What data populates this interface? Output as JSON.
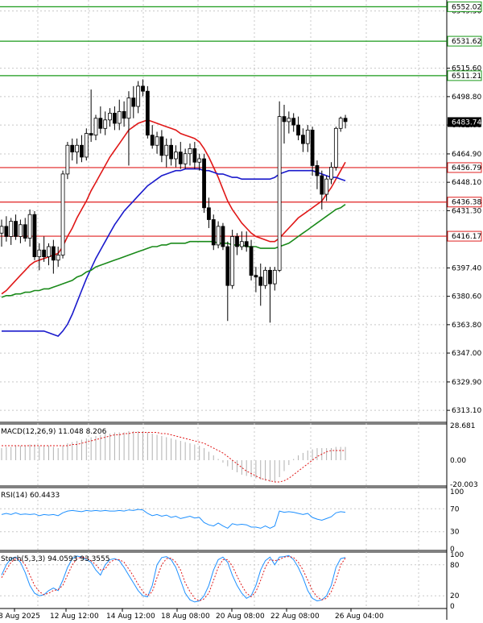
{
  "chart_data": {
    "type": "candlestick",
    "symbol_hidden": true,
    "y_axis": {
      "ticks": [
        6549.5,
        6515.6,
        6498.8,
        6482.0,
        6464.9,
        6448.1,
        6431.3,
        6397.4,
        6380.6,
        6363.8,
        6347.0,
        6329.9,
        6313.1
      ],
      "tick_labels": [
        "6549.50",
        "6515.60",
        "6498.80",
        "6482.00",
        "6464.90",
        "6448.10",
        "6431.30",
        "6397.40",
        "6380.60",
        "6363.80",
        "6347.00",
        "6329.90",
        "6313.10"
      ],
      "range": [
        6306,
        6556
      ]
    },
    "x_axis": {
      "tick_labels": [
        "8 Aug 2025",
        "12 Aug 12:00",
        "14 Aug 12:00",
        "18 Aug 08:00",
        "20 Aug 08:00",
        "22 Aug 08:00",
        "26 Aug 04:00"
      ]
    },
    "current_price": {
      "value": 6483.74,
      "label": "6483.74",
      "color": "#000000"
    },
    "levels": [
      {
        "value": 6552.02,
        "label": "6552.02",
        "color": "#1a9a1a"
      },
      {
        "value": 6531.62,
        "label": "6531.62",
        "color": "#1a9a1a"
      },
      {
        "value": 6511.21,
        "label": "6511.21",
        "color": "#1a9a1a"
      },
      {
        "value": 6456.79,
        "label": "6456.79",
        "color": "#e02020"
      },
      {
        "value": 6436.38,
        "label": "6436.38",
        "color": "#e02020"
      },
      {
        "value": 6416.17,
        "label": "6416.17",
        "color": "#e02020"
      }
    ],
    "candles": [
      {
        "o": 6418,
        "h": 6426,
        "l": 6410,
        "c": 6422
      },
      {
        "o": 6422,
        "h": 6428,
        "l": 6413,
        "c": 6416
      },
      {
        "o": 6416,
        "h": 6427,
        "l": 6411,
        "c": 6425
      },
      {
        "o": 6425,
        "h": 6429,
        "l": 6414,
        "c": 6416
      },
      {
        "o": 6416,
        "h": 6426,
        "l": 6412,
        "c": 6423
      },
      {
        "o": 6423,
        "h": 6427,
        "l": 6413,
        "c": 6415
      },
      {
        "o": 6415,
        "h": 6432,
        "l": 6410,
        "c": 6429
      },
      {
        "o": 6429,
        "h": 6431,
        "l": 6402,
        "c": 6404
      },
      {
        "o": 6404,
        "h": 6412,
        "l": 6396,
        "c": 6408
      },
      {
        "o": 6408,
        "h": 6416,
        "l": 6401,
        "c": 6404
      },
      {
        "o": 6404,
        "h": 6412,
        "l": 6399,
        "c": 6410
      },
      {
        "o": 6410,
        "h": 6414,
        "l": 6394,
        "c": 6402
      },
      {
        "o": 6402,
        "h": 6410,
        "l": 6398,
        "c": 6405
      },
      {
        "o": 6405,
        "h": 6455,
        "l": 6403,
        "c": 6453
      },
      {
        "o": 6453,
        "h": 6472,
        "l": 6450,
        "c": 6470
      },
      {
        "o": 6470,
        "h": 6474,
        "l": 6461,
        "c": 6466
      },
      {
        "o": 6466,
        "h": 6474,
        "l": 6459,
        "c": 6470
      },
      {
        "o": 6470,
        "h": 6476,
        "l": 6460,
        "c": 6463
      },
      {
        "o": 6463,
        "h": 6480,
        "l": 6461,
        "c": 6477
      },
      {
        "o": 6477,
        "h": 6503,
        "l": 6472,
        "c": 6476
      },
      {
        "o": 6476,
        "h": 6488,
        "l": 6473,
        "c": 6486
      },
      {
        "o": 6486,
        "h": 6493,
        "l": 6477,
        "c": 6480
      },
      {
        "o": 6480,
        "h": 6490,
        "l": 6476,
        "c": 6485
      },
      {
        "o": 6485,
        "h": 6492,
        "l": 6481,
        "c": 6489
      },
      {
        "o": 6489,
        "h": 6493,
        "l": 6479,
        "c": 6483
      },
      {
        "o": 6483,
        "h": 6497,
        "l": 6479,
        "c": 6490
      },
      {
        "o": 6490,
        "h": 6496,
        "l": 6481,
        "c": 6486
      },
      {
        "o": 6486,
        "h": 6502,
        "l": 6458,
        "c": 6498
      },
      {
        "o": 6498,
        "h": 6505,
        "l": 6486,
        "c": 6493
      },
      {
        "o": 6493,
        "h": 6508,
        "l": 6489,
        "c": 6505
      },
      {
        "o": 6505,
        "h": 6509,
        "l": 6499,
        "c": 6502
      },
      {
        "o": 6502,
        "h": 6505,
        "l": 6474,
        "c": 6476
      },
      {
        "o": 6476,
        "h": 6482,
        "l": 6468,
        "c": 6470
      },
      {
        "o": 6470,
        "h": 6478,
        "l": 6465,
        "c": 6475
      },
      {
        "o": 6475,
        "h": 6479,
        "l": 6460,
        "c": 6464
      },
      {
        "o": 6464,
        "h": 6474,
        "l": 6457,
        "c": 6470
      },
      {
        "o": 6470,
        "h": 6474,
        "l": 6458,
        "c": 6462
      },
      {
        "o": 6462,
        "h": 6470,
        "l": 6457,
        "c": 6466
      },
      {
        "o": 6466,
        "h": 6472,
        "l": 6456,
        "c": 6459
      },
      {
        "o": 6459,
        "h": 6468,
        "l": 6456,
        "c": 6465
      },
      {
        "o": 6465,
        "h": 6471,
        "l": 6458,
        "c": 6468
      },
      {
        "o": 6468,
        "h": 6472,
        "l": 6456,
        "c": 6460
      },
      {
        "o": 6460,
        "h": 6465,
        "l": 6455,
        "c": 6462
      },
      {
        "o": 6462,
        "h": 6465,
        "l": 6430,
        "c": 6433
      },
      {
        "o": 6433,
        "h": 6439,
        "l": 6421,
        "c": 6426
      },
      {
        "o": 6426,
        "h": 6429,
        "l": 6408,
        "c": 6411
      },
      {
        "o": 6411,
        "h": 6425,
        "l": 6409,
        "c": 6422
      },
      {
        "o": 6422,
        "h": 6424,
        "l": 6408,
        "c": 6410
      },
      {
        "o": 6410,
        "h": 6413,
        "l": 6366,
        "c": 6387
      },
      {
        "o": 6387,
        "h": 6420,
        "l": 6385,
        "c": 6416
      },
      {
        "o": 6416,
        "h": 6418,
        "l": 6405,
        "c": 6410
      },
      {
        "o": 6410,
        "h": 6419,
        "l": 6408,
        "c": 6413
      },
      {
        "o": 6413,
        "h": 6419,
        "l": 6407,
        "c": 6410
      },
      {
        "o": 6410,
        "h": 6414,
        "l": 6390,
        "c": 6393
      },
      {
        "o": 6393,
        "h": 6398,
        "l": 6383,
        "c": 6392
      },
      {
        "o": 6392,
        "h": 6400,
        "l": 6375,
        "c": 6387
      },
      {
        "o": 6387,
        "h": 6398,
        "l": 6385,
        "c": 6396
      },
      {
        "o": 6396,
        "h": 6398,
        "l": 6365,
        "c": 6388
      },
      {
        "o": 6388,
        "h": 6398,
        "l": 6384,
        "c": 6396
      },
      {
        "o": 6396,
        "h": 6496,
        "l": 6395,
        "c": 6487
      },
      {
        "o": 6487,
        "h": 6494,
        "l": 6471,
        "c": 6484
      },
      {
        "o": 6484,
        "h": 6490,
        "l": 6477,
        "c": 6486
      },
      {
        "o": 6486,
        "h": 6489,
        "l": 6478,
        "c": 6482
      },
      {
        "o": 6482,
        "h": 6487,
        "l": 6473,
        "c": 6476
      },
      {
        "o": 6476,
        "h": 6480,
        "l": 6466,
        "c": 6471
      },
      {
        "o": 6471,
        "h": 6482,
        "l": 6466,
        "c": 6479
      },
      {
        "o": 6479,
        "h": 6481,
        "l": 6452,
        "c": 6458
      },
      {
        "o": 6458,
        "h": 6461,
        "l": 6444,
        "c": 6452
      },
      {
        "o": 6452,
        "h": 6455,
        "l": 6432,
        "c": 6441
      },
      {
        "o": 6441,
        "h": 6452,
        "l": 6437,
        "c": 6450
      },
      {
        "o": 6450,
        "h": 6460,
        "l": 6447,
        "c": 6457
      },
      {
        "o": 6457,
        "h": 6481,
        "l": 6455,
        "c": 6480
      },
      {
        "o": 6480,
        "h": 6487,
        "l": 6478,
        "c": 6486
      },
      {
        "o": 6486,
        "h": 6488,
        "l": 6480,
        "c": 6484
      }
    ],
    "moving_averages": [
      {
        "color": "#e01818",
        "values": [
          6382,
          6384,
          6387,
          6390,
          6393,
          6396,
          6399,
          6401,
          6402,
          6403,
          6404,
          6405,
          6406,
          6410,
          6416,
          6421,
          6427,
          6432,
          6437,
          6443,
          6448,
          6453,
          6458,
          6463,
          6467,
          6471,
          6475,
          6479,
          6481,
          6483,
          6484,
          6485,
          6484,
          6483,
          6482,
          6481,
          6480,
          6479,
          6477,
          6476,
          6475,
          6474,
          6472,
          6468,
          6463,
          6457,
          6451,
          6444,
          6437,
          6432,
          6428,
          6424,
          6421,
          6418,
          6416,
          6415,
          6414,
          6413,
          6413,
          6415,
          6418,
          6421,
          6424,
          6427,
          6429,
          6431,
          6433,
          6435,
          6437,
          6441,
          6445,
          6450,
          6455,
          6460
        ]
      },
      {
        "color": "#1a1acc",
        "values": [
          6360,
          6360,
          6360,
          6360,
          6360,
          6360,
          6360,
          6360,
          6360,
          6360,
          6359,
          6358,
          6357,
          6360,
          6364,
          6370,
          6377,
          6384,
          6391,
          6397,
          6403,
          6408,
          6413,
          6418,
          6423,
          6427,
          6431,
          6434,
          6437,
          6440,
          6443,
          6446,
          6448,
          6450,
          6452,
          6453,
          6454,
          6455,
          6455,
          6456,
          6456,
          6456,
          6456,
          6455,
          6455,
          6454,
          6453,
          6453,
          6452,
          6451,
          6451,
          6450,
          6450,
          6450,
          6450,
          6450,
          6450,
          6450,
          6451,
          6453,
          6454,
          6455,
          6455,
          6455,
          6455,
          6455,
          6455,
          6454,
          6453,
          6452,
          6451,
          6451,
          6450,
          6449
        ]
      },
      {
        "color": "#1a8a1a",
        "values": [
          6380,
          6381,
          6381,
          6382,
          6382,
          6383,
          6383,
          6384,
          6384,
          6385,
          6385,
          6386,
          6387,
          6388,
          6389,
          6390,
          6392,
          6393,
          6395,
          6396,
          6398,
          6399,
          6400,
          6401,
          6402,
          6403,
          6404,
          6405,
          6406,
          6407,
          6408,
          6409,
          6410,
          6410,
          6411,
          6411,
          6412,
          6412,
          6412,
          6412,
          6413,
          6413,
          6413,
          6413,
          6413,
          6413,
          6412,
          6412,
          6412,
          6411,
          6411,
          6411,
          6410,
          6410,
          6410,
          6409,
          6409,
          6409,
          6409,
          6410,
          6411,
          6412,
          6414,
          6416,
          6418,
          6420,
          6422,
          6424,
          6426,
          6428,
          6430,
          6432,
          6433,
          6435
        ]
      }
    ],
    "macd": {
      "label": "MACD(12,26,9) 11.048 8.206",
      "tick_labels": [
        "28.681",
        "0.00",
        "-20.003"
      ],
      "range": [
        -20.003,
        28.681
      ],
      "histogram": [
        10,
        11,
        11,
        12,
        12,
        12,
        13,
        13,
        12,
        12,
        12,
        11,
        10,
        12,
        14,
        15,
        16,
        17,
        18,
        19,
        20,
        21,
        22,
        22,
        23,
        23,
        23,
        24,
        24,
        24,
        24,
        23,
        22,
        21,
        20,
        19,
        18,
        17,
        16,
        15,
        14,
        13,
        12,
        10,
        7,
        4,
        1,
        -2,
        -5,
        -8,
        -10,
        -12,
        -13,
        -14,
        -15,
        -16,
        -17,
        -18,
        -18,
        -14,
        -9,
        -4,
        1,
        4,
        6,
        8,
        9,
        10,
        10,
        10,
        10,
        11,
        11,
        11
      ],
      "signal": [
        12,
        12,
        12,
        12,
        12,
        12,
        12,
        12,
        12,
        12,
        12,
        12,
        12,
        12,
        12,
        13,
        13,
        14,
        15,
        16,
        17,
        18,
        19,
        20,
        21,
        21,
        22,
        22,
        23,
        23,
        23,
        23,
        23,
        23,
        22,
        22,
        21,
        20,
        19,
        18,
        17,
        16,
        15,
        14,
        12,
        10,
        8,
        6,
        3,
        0,
        -3,
        -6,
        -9,
        -11,
        -13,
        -15,
        -16,
        -17,
        -18,
        -18,
        -17,
        -15,
        -12,
        -9,
        -6,
        -3,
        0,
        3,
        5,
        7,
        8,
        8,
        8,
        8
      ]
    },
    "rsi": {
      "label": "RSI(14) 60.4433",
      "tick_labels": [
        "100",
        "70",
        "30",
        "0"
      ],
      "range": [
        0,
        100
      ],
      "values": [
        60,
        62,
        60,
        63,
        60,
        61,
        60,
        61,
        58,
        60,
        59,
        60,
        58,
        63,
        66,
        67,
        66,
        65,
        67,
        66,
        67,
        66,
        67,
        66,
        66,
        67,
        66,
        68,
        67,
        69,
        68,
        62,
        58,
        60,
        57,
        59,
        55,
        57,
        53,
        55,
        57,
        54,
        55,
        46,
        42,
        40,
        45,
        40,
        36,
        44,
        42,
        43,
        42,
        38,
        38,
        36,
        40,
        36,
        40,
        66,
        64,
        65,
        64,
        62,
        60,
        62,
        55,
        52,
        50,
        53,
        56,
        63,
        65,
        64
      ]
    },
    "stoch": {
      "label": "Stoch(5,3,3) 94.0593 93.3555",
      "tick_labels": [
        "100",
        "80",
        "20",
        "0"
      ],
      "range": [
        0,
        100
      ],
      "k": [
        60,
        80,
        92,
        95,
        85,
        65,
        40,
        25,
        20,
        22,
        30,
        35,
        30,
        50,
        75,
        92,
        97,
        95,
        90,
        85,
        70,
        60,
        80,
        90,
        92,
        88,
        75,
        60,
        45,
        30,
        20,
        18,
        40,
        80,
        94,
        96,
        90,
        75,
        50,
        25,
        12,
        8,
        10,
        20,
        40,
        70,
        90,
        95,
        85,
        60,
        40,
        25,
        15,
        20,
        40,
        70,
        88,
        95,
        80,
        95,
        96,
        98,
        90,
        75,
        55,
        30,
        15,
        10,
        12,
        20,
        40,
        75,
        92,
        94
      ],
      "d": [
        55,
        70,
        85,
        92,
        90,
        80,
        60,
        40,
        28,
        22,
        25,
        30,
        32,
        40,
        60,
        80,
        92,
        95,
        93,
        88,
        80,
        70,
        72,
        85,
        90,
        90,
        85,
        72,
        58,
        42,
        28,
        20,
        28,
        55,
        80,
        92,
        93,
        85,
        70,
        45,
        28,
        15,
        10,
        14,
        25,
        50,
        75,
        90,
        90,
        78,
        58,
        40,
        25,
        18,
        28,
        50,
        75,
        90,
        88,
        90,
        95,
        96,
        94,
        85,
        70,
        50,
        30,
        18,
        12,
        15,
        28,
        50,
        80,
        93
      ]
    }
  }
}
